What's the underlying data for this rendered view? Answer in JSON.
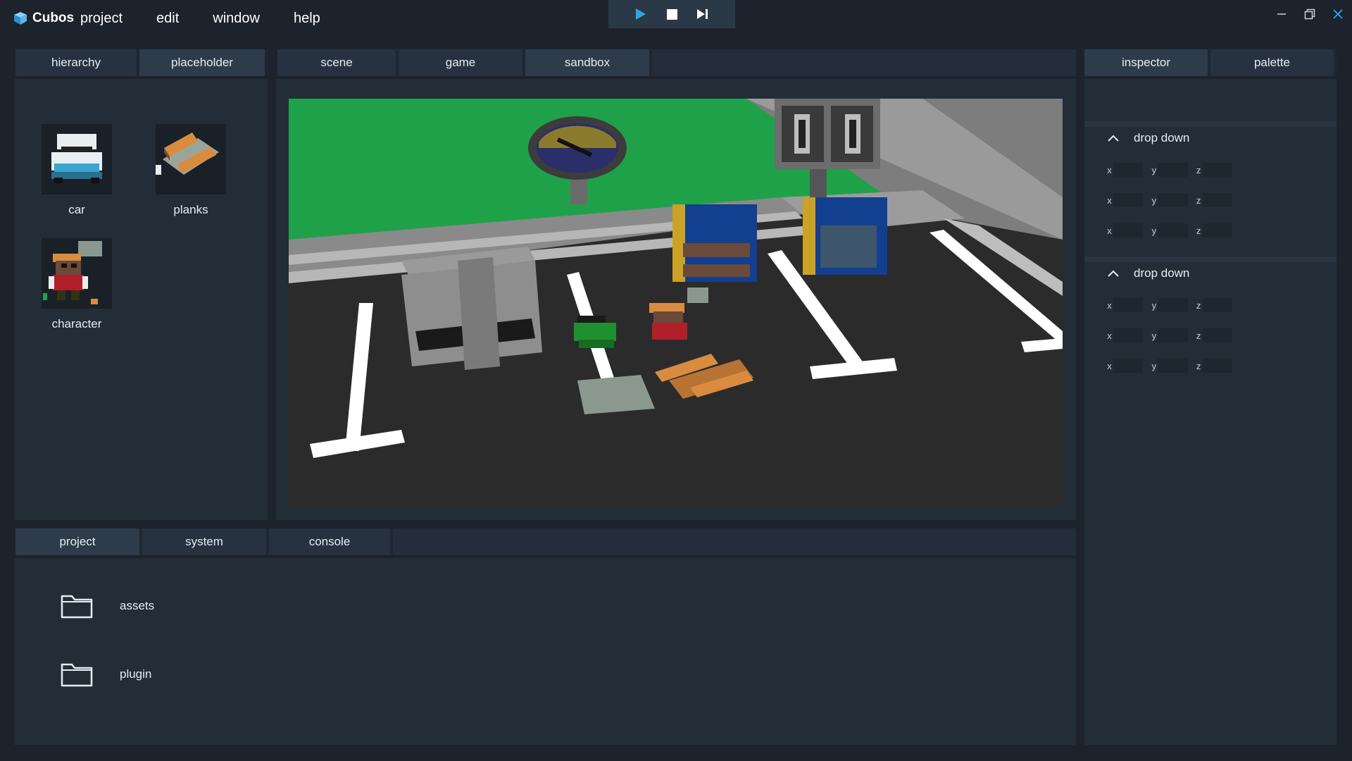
{
  "app": {
    "name": "Cubos"
  },
  "menu": [
    "project",
    "edit",
    "window",
    "help"
  ],
  "left_panel": {
    "tabs": [
      "hierarchy",
      "placeholder"
    ],
    "active_tab": 1,
    "assets": [
      "car",
      "planks",
      "character"
    ]
  },
  "center_panel": {
    "tabs": [
      "scene",
      "game",
      "sandbox"
    ],
    "active_tab": 2
  },
  "right_panel": {
    "tabs": [
      "inspector",
      "palette"
    ],
    "active_tab": 0,
    "sections": [
      {
        "title": "drop down",
        "rows": [
          [
            "x",
            "y",
            "z"
          ],
          [
            "x",
            "y",
            "z"
          ],
          [
            "x",
            "y",
            "z"
          ]
        ]
      },
      {
        "title": "drop down",
        "rows": [
          [
            "x",
            "y",
            "z"
          ],
          [
            "x",
            "y",
            "z"
          ],
          [
            "x",
            "y",
            "z"
          ]
        ]
      }
    ]
  },
  "bottom_panel": {
    "tabs": [
      "project",
      "system",
      "console"
    ],
    "active_tab": 0,
    "folders": [
      "assets",
      "plugin"
    ]
  },
  "icons": {
    "play": "play-icon",
    "stop": "stop-icon",
    "step": "step-icon",
    "minimize": "minimize-icon",
    "restore": "restore-icon",
    "close": "close-icon",
    "collapse": "chevron-up-icon",
    "folder": "folder-icon"
  },
  "colors": {
    "accent": "#2aa7e8",
    "scene_green": "#1fa14a"
  }
}
